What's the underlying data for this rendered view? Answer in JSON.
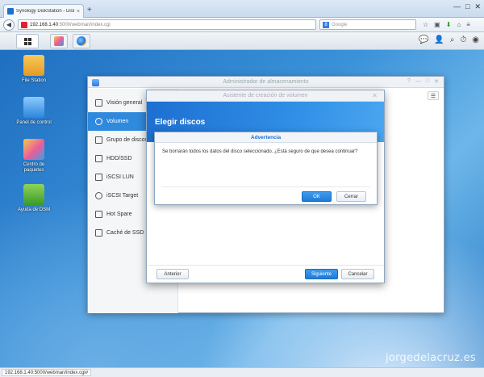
{
  "browser": {
    "tab_title": "Synology DiskStation - DiskSta...",
    "tab_close": "×",
    "new_tab": "+",
    "win_buttons": [
      "—",
      "□",
      "✕"
    ],
    "url_main": "192.168.1.40",
    "url_rest": ":5000/webman/index.cgi",
    "search_placeholder": "Google",
    "search_engine_letter": "8",
    "nav_icons": [
      "☆",
      "▣",
      "⬇",
      "⌂",
      "≡"
    ]
  },
  "taskbar": {
    "tray_icons": [
      "💬",
      "👤",
      "⌕",
      "⏱",
      "◉"
    ]
  },
  "desktop": {
    "icons": [
      {
        "label": "File Station"
      },
      {
        "label": "Panel de control"
      },
      {
        "label": "Centro de paquetes"
      },
      {
        "label": "Ayuda de DSM"
      }
    ]
  },
  "storage_window": {
    "title": "Administrador de almacenamiento",
    "controls": [
      "?",
      "—",
      "□",
      "✕"
    ],
    "sidebar": [
      {
        "label": "Visión general"
      },
      {
        "label": "Volumen"
      },
      {
        "label": "Grupo de discos"
      },
      {
        "label": "HDD/SSD"
      },
      {
        "label": "iSCSI LUN"
      },
      {
        "label": "iSCSI Target"
      },
      {
        "label": "Hot Spare"
      },
      {
        "label": "Caché de SSD"
      }
    ],
    "toolbar_icon": "☰"
  },
  "wizard": {
    "title": "Asistente de creación de volumen",
    "close": "✕",
    "header": "Elegir discos",
    "back_label": "Anterior",
    "next_label": "Siguiente",
    "cancel_label": "Cancelar"
  },
  "alert": {
    "title": "Advertencia",
    "message": "Se borrarán todos los datos del disco seleccionado. ¿Está seguro de que desea continuar?",
    "ok_label": "OK",
    "cancel_label": "Cerrar"
  },
  "statusbar": {
    "text": "192.168.1.40:5000/webman/index.cgi#"
  },
  "watermark": "jorgedelacruz.es"
}
